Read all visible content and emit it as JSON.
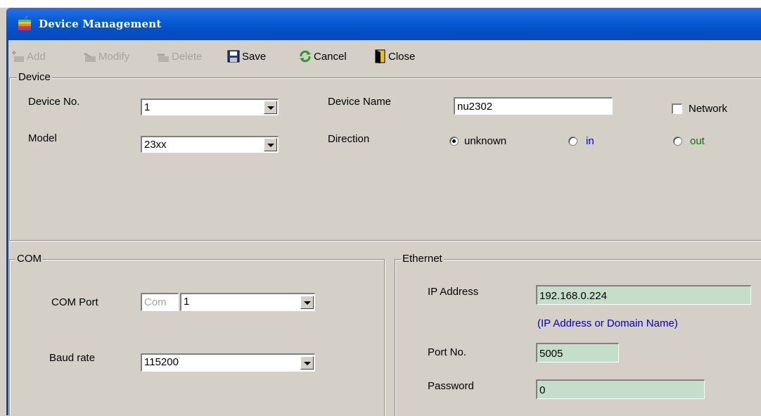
{
  "window": {
    "title": "Device Management"
  },
  "toolbar": {
    "add": "Add",
    "modify": "Modify",
    "delete": "Delete",
    "save": "Save",
    "cancel": "Cancel",
    "close": "Close"
  },
  "device": {
    "group_label": "Device",
    "device_no_label": "Device No.",
    "device_no_value": "1",
    "model_label": "Model",
    "model_value": "23xx",
    "device_name_label": "Device Name",
    "device_name_value": "nu2302",
    "network_label": "Network",
    "direction_label": "Direction",
    "direction_options": [
      "unknown",
      "in",
      "out"
    ],
    "direction_selected": "unknown"
  },
  "com": {
    "group_label": "COM",
    "com_port_label": "COM Port",
    "com_prefix": "Com",
    "com_port_value": "1",
    "baud_rate_label": "Baud rate",
    "baud_rate_value": "115200"
  },
  "ethernet": {
    "group_label": "Ethernet",
    "ip_label": "IP Address",
    "ip_value": "192.168.0.224",
    "ip_hint": "(IP Address or Domain Name)",
    "port_label": "Port No.",
    "port_value": "5005",
    "password_label": "Password",
    "password_value": "0"
  },
  "colors": {
    "title_bar": "#0a5fd6",
    "in_option": "#0000cc",
    "out_option": "#007a00",
    "hint": "#0000cc",
    "ethernet_fields": "#c5dec9"
  }
}
